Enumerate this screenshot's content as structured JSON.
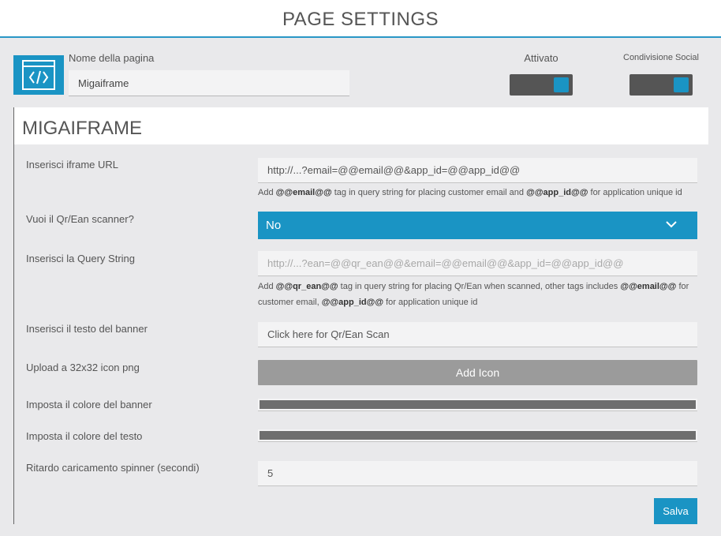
{
  "header": {
    "title": "PAGE SETTINGS"
  },
  "page": {
    "name_label": "Nome della pagina",
    "name_value": "Migaiframe",
    "active_label": "Attivato",
    "social_label": "Condivisione Social"
  },
  "panel": {
    "title": "MIGAIFRAME",
    "iframe_url": {
      "label": "Inserisci iframe URL",
      "value": "http://...?email=@@email@@&app_id=@@app_id@@",
      "help_pre": "Add ",
      "help_tag1": "@@email@@",
      "help_mid": " tag in query string for placing customer email and ",
      "help_tag2": "@@app_id@@",
      "help_post": " for application unique id"
    },
    "scanner": {
      "label": "Vuoi il Qr/Ean scanner?",
      "value": "No"
    },
    "query_string": {
      "label": "Inserisci la Query String",
      "placeholder": "http://...?ean=@@qr_ean@@&email=@@email@@&app_id=@@app_id@@",
      "help_pre": "Add ",
      "help_tag1": "@@qr_ean@@",
      "help_mid1": " tag in query string for placing Qr/Ean when scanned, other tags includes ",
      "help_tag2": "@@email@@",
      "help_mid2": " for customer email, ",
      "help_tag3": "@@app_id@@",
      "help_post": " for application unique id"
    },
    "banner_text": {
      "label": "Inserisci il testo del banner",
      "value": "Click here for Qr/Ean Scan"
    },
    "icon_upload": {
      "label": "Upload a 32x32 icon png",
      "button": "Add Icon"
    },
    "banner_color": {
      "label": "Imposta il colore del banner",
      "color": "#6e6e6e"
    },
    "text_color": {
      "label": "Imposta il colore del testo",
      "color": "#6e6e6e"
    },
    "spinner_delay": {
      "label": "Ritardo caricamento spinner (secondi)",
      "value": "5"
    },
    "save_label": "Salva"
  },
  "colors": {
    "accent": "#1a94c4",
    "toggle_bg": "#555555",
    "button_gray": "#9b9b9b"
  },
  "icons": {
    "page_icon": "code-window-icon",
    "select_icon": "chevron-down-icon"
  },
  "toggles": {
    "active_on": true,
    "social_on": true
  }
}
